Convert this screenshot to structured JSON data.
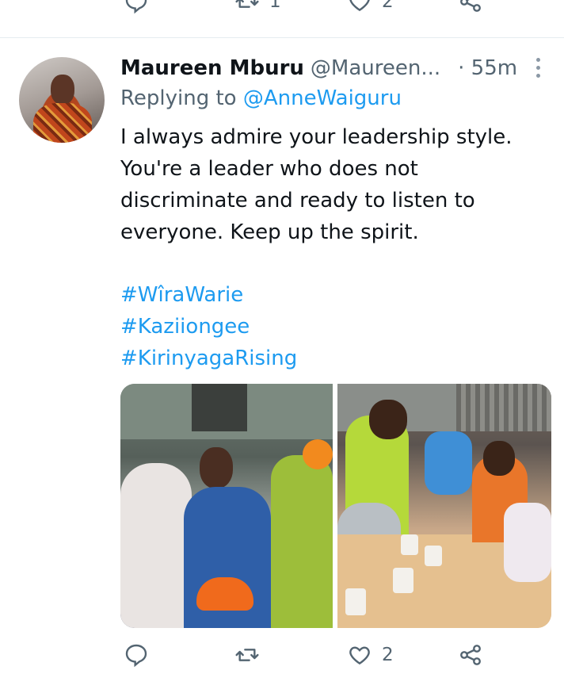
{
  "top_actions": {
    "reply_count": "",
    "retweet_count": "1",
    "like_count": "2"
  },
  "tweet": {
    "author_name": "Maureen Mburu",
    "author_handle": "@Maureen...",
    "time": "· 55m",
    "replying_prefix": "Replying to ",
    "replying_to": "@AnneWaiguru",
    "text_lines": [
      "I always admire your leadership style.",
      "You're a leader who does not",
      "discriminate and ready to listen to",
      "everyone. Keep up the spirit."
    ],
    "hashtags": [
      "#WîraWarie",
      "#Kaziiongee",
      "#KirinyagaRising"
    ]
  },
  "bottom_actions": {
    "reply_count": "",
    "retweet_count": "",
    "like_count": "2"
  },
  "colors": {
    "accent": "#1d9bf0",
    "muted": "#536471",
    "text": "#0f1419"
  },
  "icons": [
    "reply-icon",
    "retweet-icon",
    "like-icon",
    "share-icon",
    "more-icon"
  ]
}
